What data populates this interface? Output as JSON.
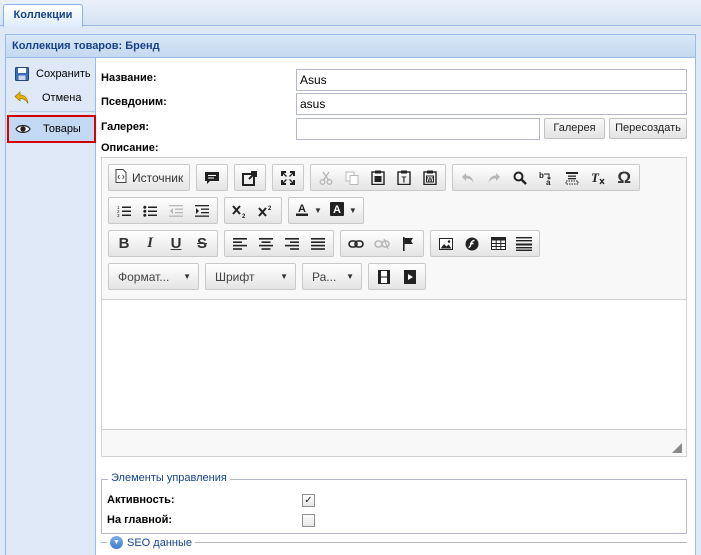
{
  "tabs": [
    {
      "label": "Коллекции"
    }
  ],
  "panel": {
    "title": "Коллекция товаров: Бренд"
  },
  "sidebar": {
    "save_label": "Сохранить",
    "cancel_label": "Отмена",
    "products_label": "Товары"
  },
  "form": {
    "name_label": "Название:",
    "name_value": "Asus",
    "alias_label": "Псевдоним:",
    "alias_value": "asus",
    "gallery_label": "Галерея:",
    "gallery_value": "",
    "gallery_button": "Галерея",
    "recreate_button": "Пересоздать",
    "description_label": "Описание:"
  },
  "editor": {
    "source_label": "Источник",
    "format_label": "Формат...",
    "font_label": "Шрифт",
    "size_label": "Ра..."
  },
  "controls": {
    "legend": "Элементы управления",
    "active_label": "Активность:",
    "active_checked": true,
    "home_label": "На главной:",
    "home_checked": false
  },
  "seo": {
    "label": "SEO данные"
  },
  "colors": {
    "accent": "#15428b",
    "highlight_border": "#d60000",
    "panel_border": "#99bbe8"
  }
}
